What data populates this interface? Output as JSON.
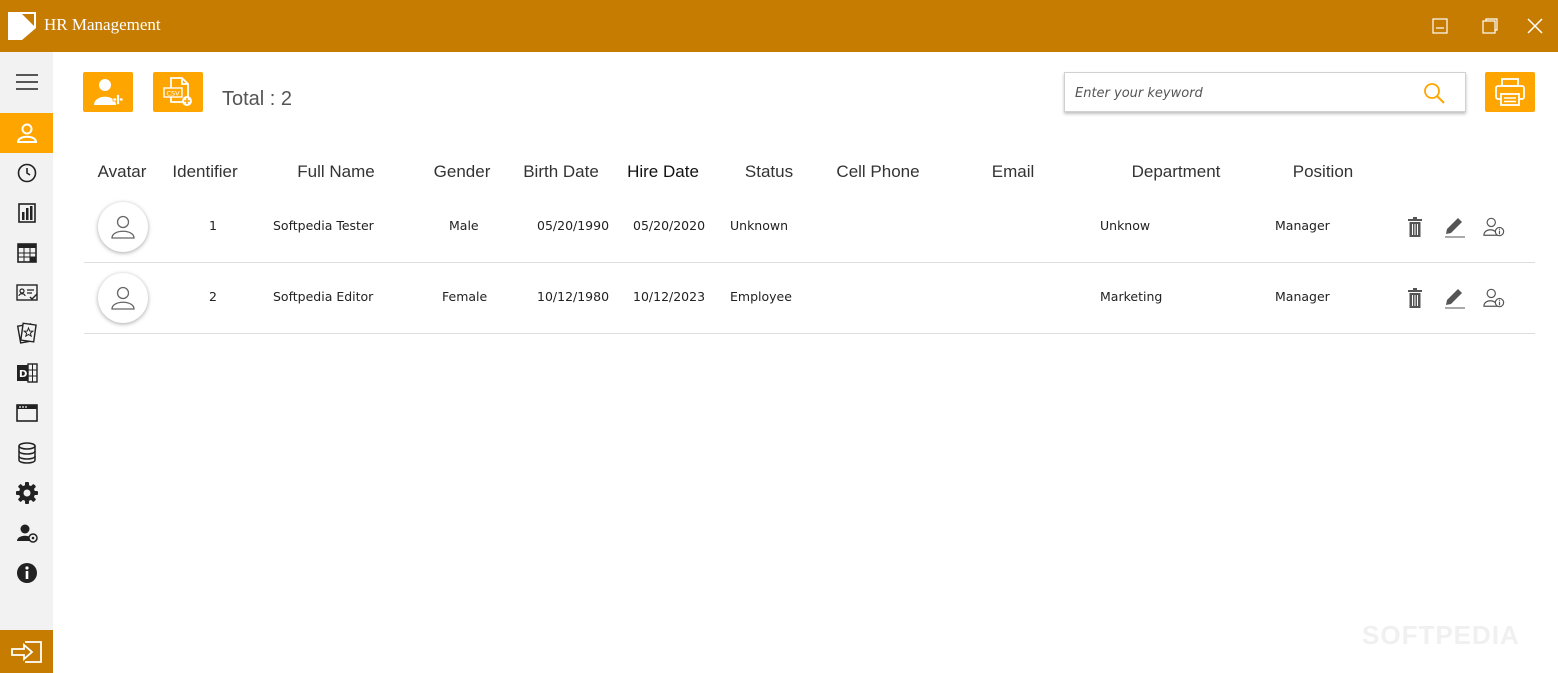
{
  "window": {
    "title": "HR Management"
  },
  "sidebar": {
    "items": [
      {
        "icon": "menu-icon"
      },
      {
        "icon": "employee-icon",
        "active": true
      },
      {
        "icon": "clock-icon"
      },
      {
        "icon": "bar-chart-icon"
      },
      {
        "icon": "calendar-icon"
      },
      {
        "icon": "id-card-icon"
      },
      {
        "icon": "award-icon"
      },
      {
        "icon": "department-icon"
      },
      {
        "icon": "browser-window-icon"
      },
      {
        "icon": "database-icon"
      },
      {
        "icon": "gear-icon"
      },
      {
        "icon": "user-settings-icon"
      },
      {
        "icon": "info-icon"
      },
      {
        "icon": "logout-icon"
      }
    ]
  },
  "toolbar": {
    "total_label": "Total : 2",
    "search_placeholder": "Enter your keyword"
  },
  "table": {
    "headers": [
      "Avatar",
      "Identifier",
      "Full Name",
      "Gender",
      "Birth Date",
      "Hire Date",
      "Status",
      "Cell Phone",
      "Email",
      "Department",
      "Position"
    ],
    "rows": [
      {
        "id": "1",
        "name": "Softpedia Tester",
        "gender": "Male",
        "birth": "05/20/1990",
        "hire": "05/20/2020",
        "status": "Unknown",
        "phone": "",
        "email": "",
        "department": "Unknow",
        "position": "Manager"
      },
      {
        "id": "2",
        "name": "Softpedia Editor",
        "gender": "Female",
        "birth": "10/12/1980",
        "hire": "10/12/2023",
        "status": "Employee",
        "phone": "",
        "email": "",
        "department": "Marketing",
        "position": "Manager"
      }
    ]
  },
  "watermark": "SOFTPEDIA",
  "colors": {
    "titlebar": "#c57c00",
    "accent": "#ffa500",
    "sidebar": "#f2f2f2"
  }
}
